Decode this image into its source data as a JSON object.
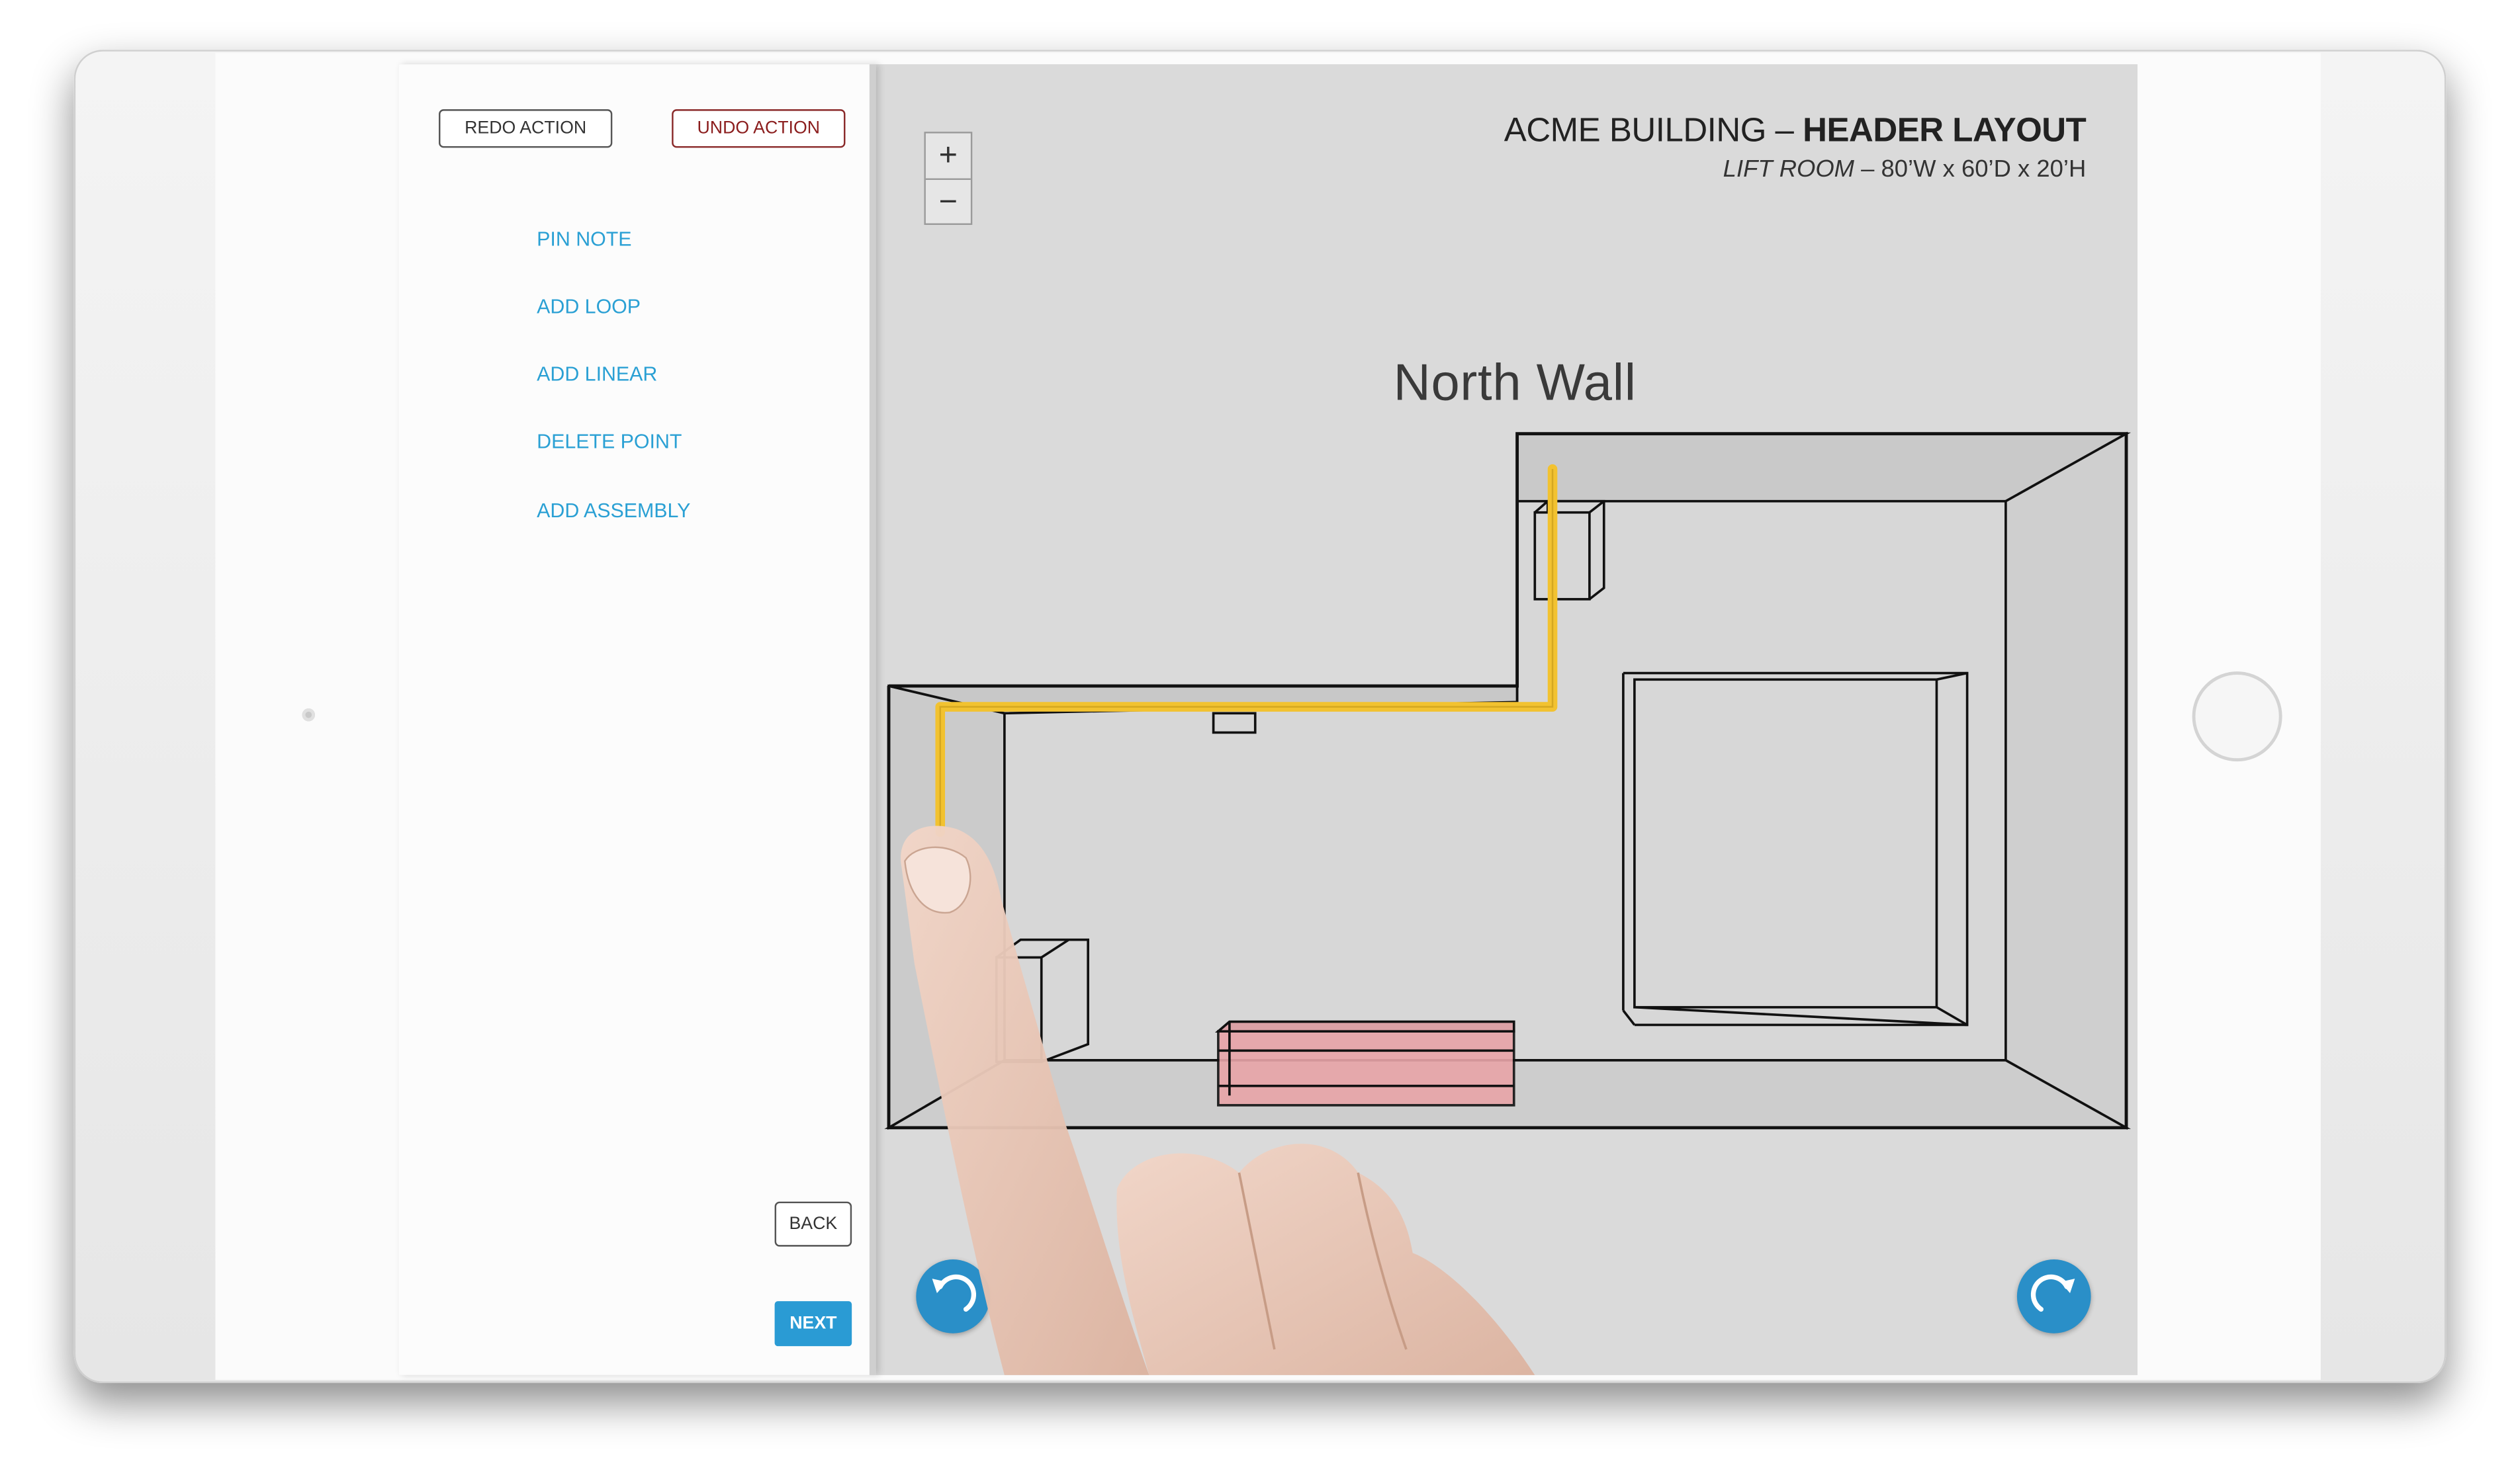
{
  "sidebar": {
    "redo_label": "REDO ACTION",
    "undo_label": "UNDO ACTION",
    "menu": [
      {
        "label": "PIN NOTE"
      },
      {
        "label": "ADD LOOP"
      },
      {
        "label": "ADD LINEAR"
      },
      {
        "label": "DELETE POINT"
      },
      {
        "label": "ADD ASSEMBLY"
      }
    ],
    "back_label": "BACK",
    "next_label": "NEXT"
  },
  "canvas": {
    "zoom_in_label": "+",
    "zoom_out_label": "−",
    "title_prefix": "ACME BUILDING – ",
    "title_bold": "HEADER LAYOUT",
    "subtitle_room": "LIFT ROOM",
    "subtitle_dims": " – 80’W x 60’D x 20’H",
    "wall_label": "North Wall",
    "icons": {
      "rotate_left": "rotate-left-icon",
      "rotate_right": "rotate-right-icon"
    },
    "colors": {
      "loop_line": "#f2c230",
      "highlight_block": "#e8a4a8",
      "accent": "#2a9bd4"
    }
  }
}
